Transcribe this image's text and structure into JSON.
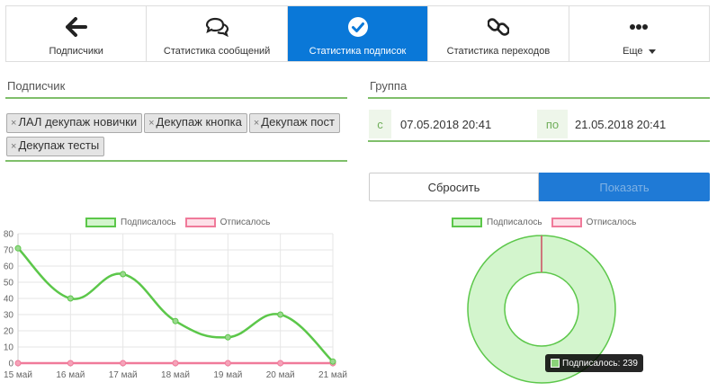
{
  "tabs": [
    {
      "label": "Подписчики",
      "icon": "arrow-left-icon",
      "active": false
    },
    {
      "label": "Статистика сообщений",
      "icon": "comments-icon",
      "active": false
    },
    {
      "label": "Статистика подписок",
      "icon": "check-circle-icon",
      "active": true
    },
    {
      "label": "Статистика переходов",
      "icon": "link-icon",
      "active": false
    },
    {
      "label": "Еще",
      "icon": "ellipsis-icon",
      "active": false
    }
  ],
  "subscriber": {
    "title": "Подписчик",
    "tags": [
      "ЛАЛ декупаж новички",
      "Декупаж кнопка",
      "Декупаж пост",
      "Декупаж тесты"
    ]
  },
  "group": {
    "title": "Группа",
    "from_label": "с",
    "from_value": "07.05.2018 20:41",
    "to_label": "по",
    "to_value": "21.05.2018 20:41"
  },
  "buttons": {
    "reset": "Сбросить",
    "show": "Показать"
  },
  "colors": {
    "accent": "#0a78d8",
    "subscribed": "#5cc74a",
    "unsubscribed": "#f07a9a",
    "rule": "#7fbf6a"
  },
  "tooltip": {
    "label": "Подписалось: 239"
  },
  "chart_data": [
    {
      "type": "line",
      "x": [
        "15 май",
        "16 май",
        "17 май",
        "18 май",
        "19 май",
        "20 май",
        "21 май"
      ],
      "series": [
        {
          "name": "Подписалось",
          "values": [
            71,
            40,
            55,
            26,
            16,
            30,
            1
          ]
        },
        {
          "name": "Отписалось",
          "values": [
            0,
            0,
            0,
            0,
            0,
            0,
            0
          ]
        }
      ],
      "ylim": [
        0,
        80
      ],
      "yticks": [
        0,
        10,
        20,
        30,
        40,
        50,
        60,
        70,
        80
      ],
      "grid": true,
      "legend": "top"
    },
    {
      "type": "pie",
      "donut": true,
      "labels": [
        "Подписалось",
        "Отписалось"
      ],
      "values": [
        239,
        0
      ],
      "legend": "top"
    }
  ]
}
